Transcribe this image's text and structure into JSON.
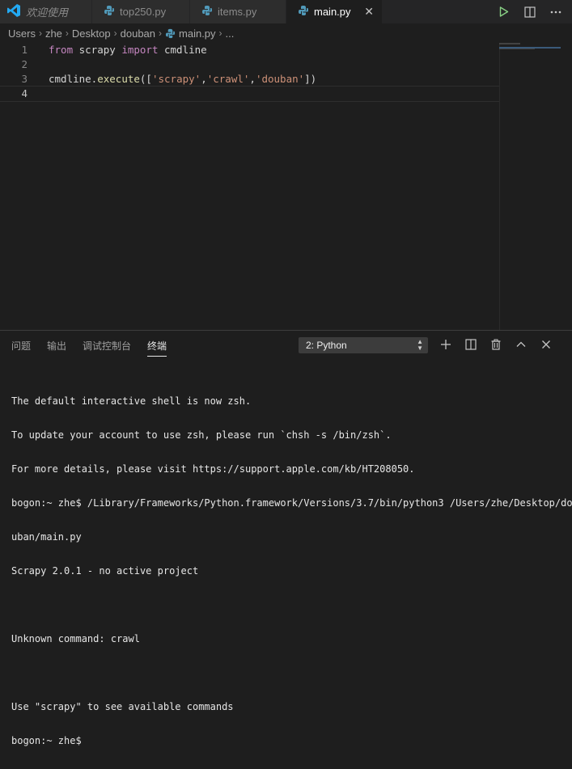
{
  "tabs": [
    {
      "label": "欢迎使用",
      "icon": "vscode-logo-icon",
      "active": false
    },
    {
      "label": "top250.py",
      "icon": "python-file-icon",
      "active": false
    },
    {
      "label": "items.py",
      "icon": "python-file-icon",
      "active": false
    },
    {
      "label": "main.py",
      "icon": "python-file-icon",
      "active": true
    }
  ],
  "breadcrumb": {
    "items": [
      "Users",
      "zhe",
      "Desktop",
      "douban",
      "main.py",
      "..."
    ]
  },
  "editor": {
    "lines": [
      {
        "num": "1",
        "tokens": [
          {
            "t": "from",
            "c": "kw"
          },
          {
            "t": " scrapy ",
            "c": ""
          },
          {
            "t": "import",
            "c": "kw"
          },
          {
            "t": " cmdline",
            "c": ""
          }
        ]
      },
      {
        "num": "2",
        "tokens": []
      },
      {
        "num": "3",
        "tokens": [
          {
            "t": "cmdline.",
            "c": ""
          },
          {
            "t": "execute",
            "c": "fn"
          },
          {
            "t": "([",
            "c": ""
          },
          {
            "t": "'scrapy'",
            "c": "str"
          },
          {
            "t": ",",
            "c": ""
          },
          {
            "t": "'crawl'",
            "c": "str"
          },
          {
            "t": ",",
            "c": ""
          },
          {
            "t": "'douban'",
            "c": "str"
          },
          {
            "t": "])",
            "c": ""
          }
        ]
      },
      {
        "num": "4",
        "tokens": []
      }
    ]
  },
  "panel": {
    "tabs": [
      "问题",
      "输出",
      "调试控制台",
      "终端"
    ],
    "active_tab": "终端",
    "terminal_select": "2: Python",
    "terminal_lines": [
      "The default interactive shell is now zsh.",
      "To update your account to use zsh, please run `chsh -s /bin/zsh`.",
      "For more details, please visit https://support.apple.com/kb/HT208050.",
      "bogon:~ zhe$ /Library/Frameworks/Python.framework/Versions/3.7/bin/python3 /Users/zhe/Desktop/do",
      "uban/main.py",
      "Scrapy 2.0.1 - no active project",
      "",
      "Unknown command: crawl",
      "",
      "Use \"scrapy\" to see available commands",
      "bogon:~ zhe$ "
    ]
  },
  "colors": {
    "background": "#1e1e1e",
    "keyword": "#c586c0",
    "string": "#ce9178",
    "function": "#dcdcaa",
    "run": "#89d185",
    "vscode_blue": "#23a9f2",
    "python_blue": "#519aba"
  }
}
